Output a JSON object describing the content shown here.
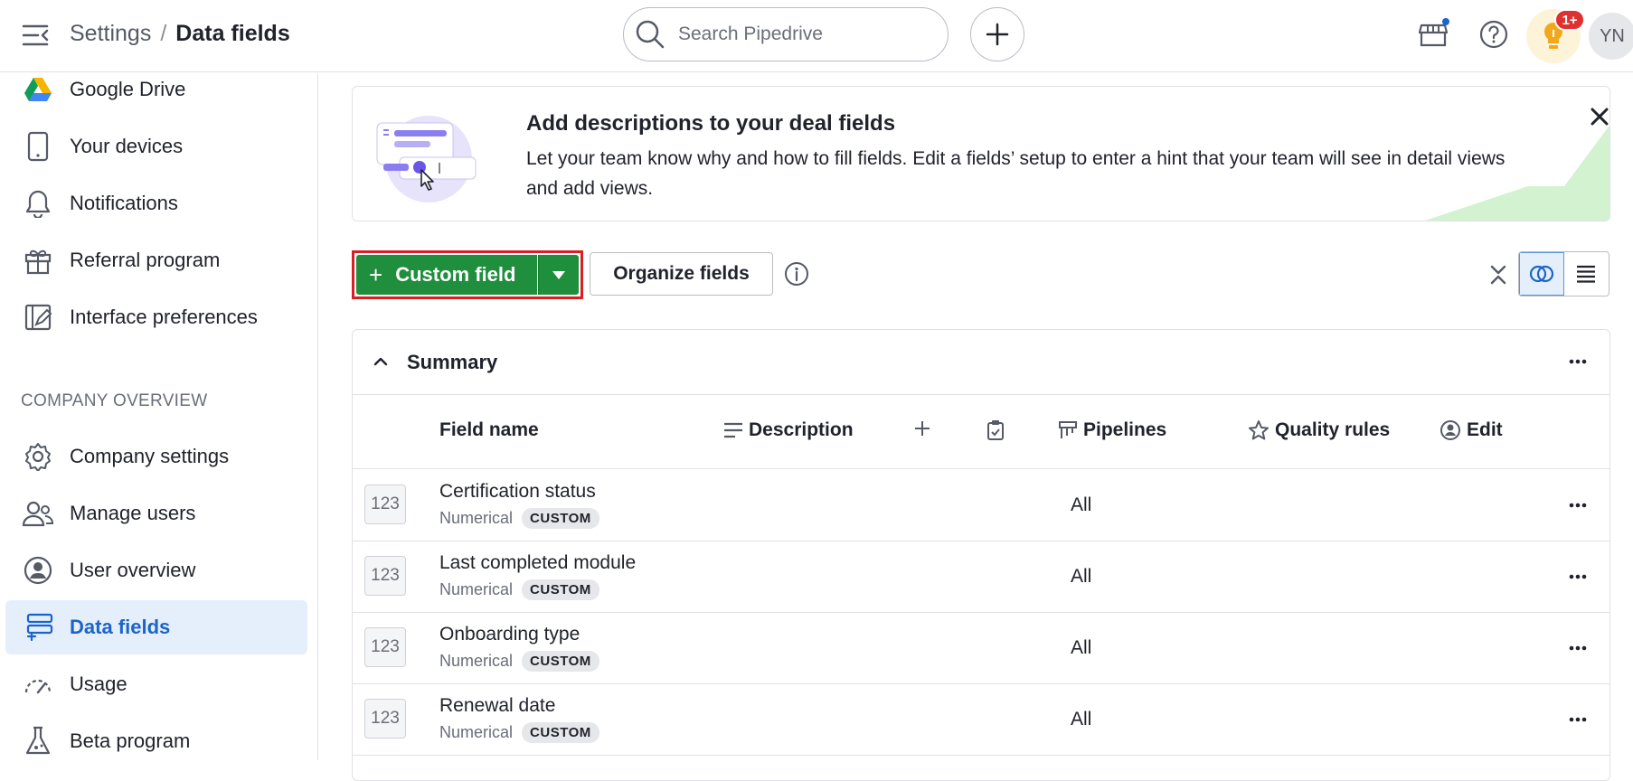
{
  "header": {
    "breadcrumb_parent": "Settings",
    "breadcrumb_sep": "/",
    "breadcrumb_current": "Data fields",
    "search_placeholder": "Search Pipedrive",
    "notifications_badge": "1+",
    "avatar_initials": "YN"
  },
  "sidebar": {
    "items_top": [
      {
        "label": "Google Drive",
        "icon": "google-drive-icon"
      },
      {
        "label": "Your devices",
        "icon": "mobile-device-icon"
      },
      {
        "label": "Notifications",
        "icon": "bell-icon"
      },
      {
        "label": "Referral program",
        "icon": "gift-icon"
      },
      {
        "label": "Interface preferences",
        "icon": "interface-pencil-icon"
      }
    ],
    "section_title": "COMPANY OVERVIEW",
    "items_company": [
      {
        "label": "Company settings",
        "icon": "gear-icon"
      },
      {
        "label": "Manage users",
        "icon": "users-icon"
      },
      {
        "label": "User overview",
        "icon": "user-circle-icon"
      },
      {
        "label": "Data fields",
        "icon": "data-fields-icon",
        "active": true
      },
      {
        "label": "Usage",
        "icon": "gauge-icon"
      },
      {
        "label": "Beta program",
        "icon": "flask-icon"
      }
    ]
  },
  "banner": {
    "title": "Add descriptions to your deal fields",
    "text": "Let your team know why and how to fill fields. Edit a fields’ setup to enter a hint that your team will see in detail views and add views."
  },
  "toolbar": {
    "custom_field_label": "Custom field",
    "organize_label": "Organize fields"
  },
  "summary": {
    "title": "Summary",
    "columns": {
      "field_name": "Field name",
      "description": "Description",
      "pipelines": "Pipelines",
      "quality_rules": "Quality rules",
      "edit": "Edit"
    },
    "rows": [
      {
        "type_icon": "123",
        "name": "Certification status",
        "type": "Numerical",
        "badge": "CUSTOM",
        "pipelines": "All"
      },
      {
        "type_icon": "123",
        "name": "Last completed module",
        "type": "Numerical",
        "badge": "CUSTOM",
        "pipelines": "All"
      },
      {
        "type_icon": "123",
        "name": "Onboarding type",
        "type": "Numerical",
        "badge": "CUSTOM",
        "pipelines": "All"
      },
      {
        "type_icon": "123",
        "name": "Renewal date",
        "type": "Numerical",
        "badge": "CUSTOM",
        "pipelines": "All"
      }
    ]
  },
  "colors": {
    "accent_green": "#1f8e3d",
    "highlight_red": "#d91e26",
    "active_blue": "#1b64c9",
    "active_bg": "#e5effc"
  }
}
